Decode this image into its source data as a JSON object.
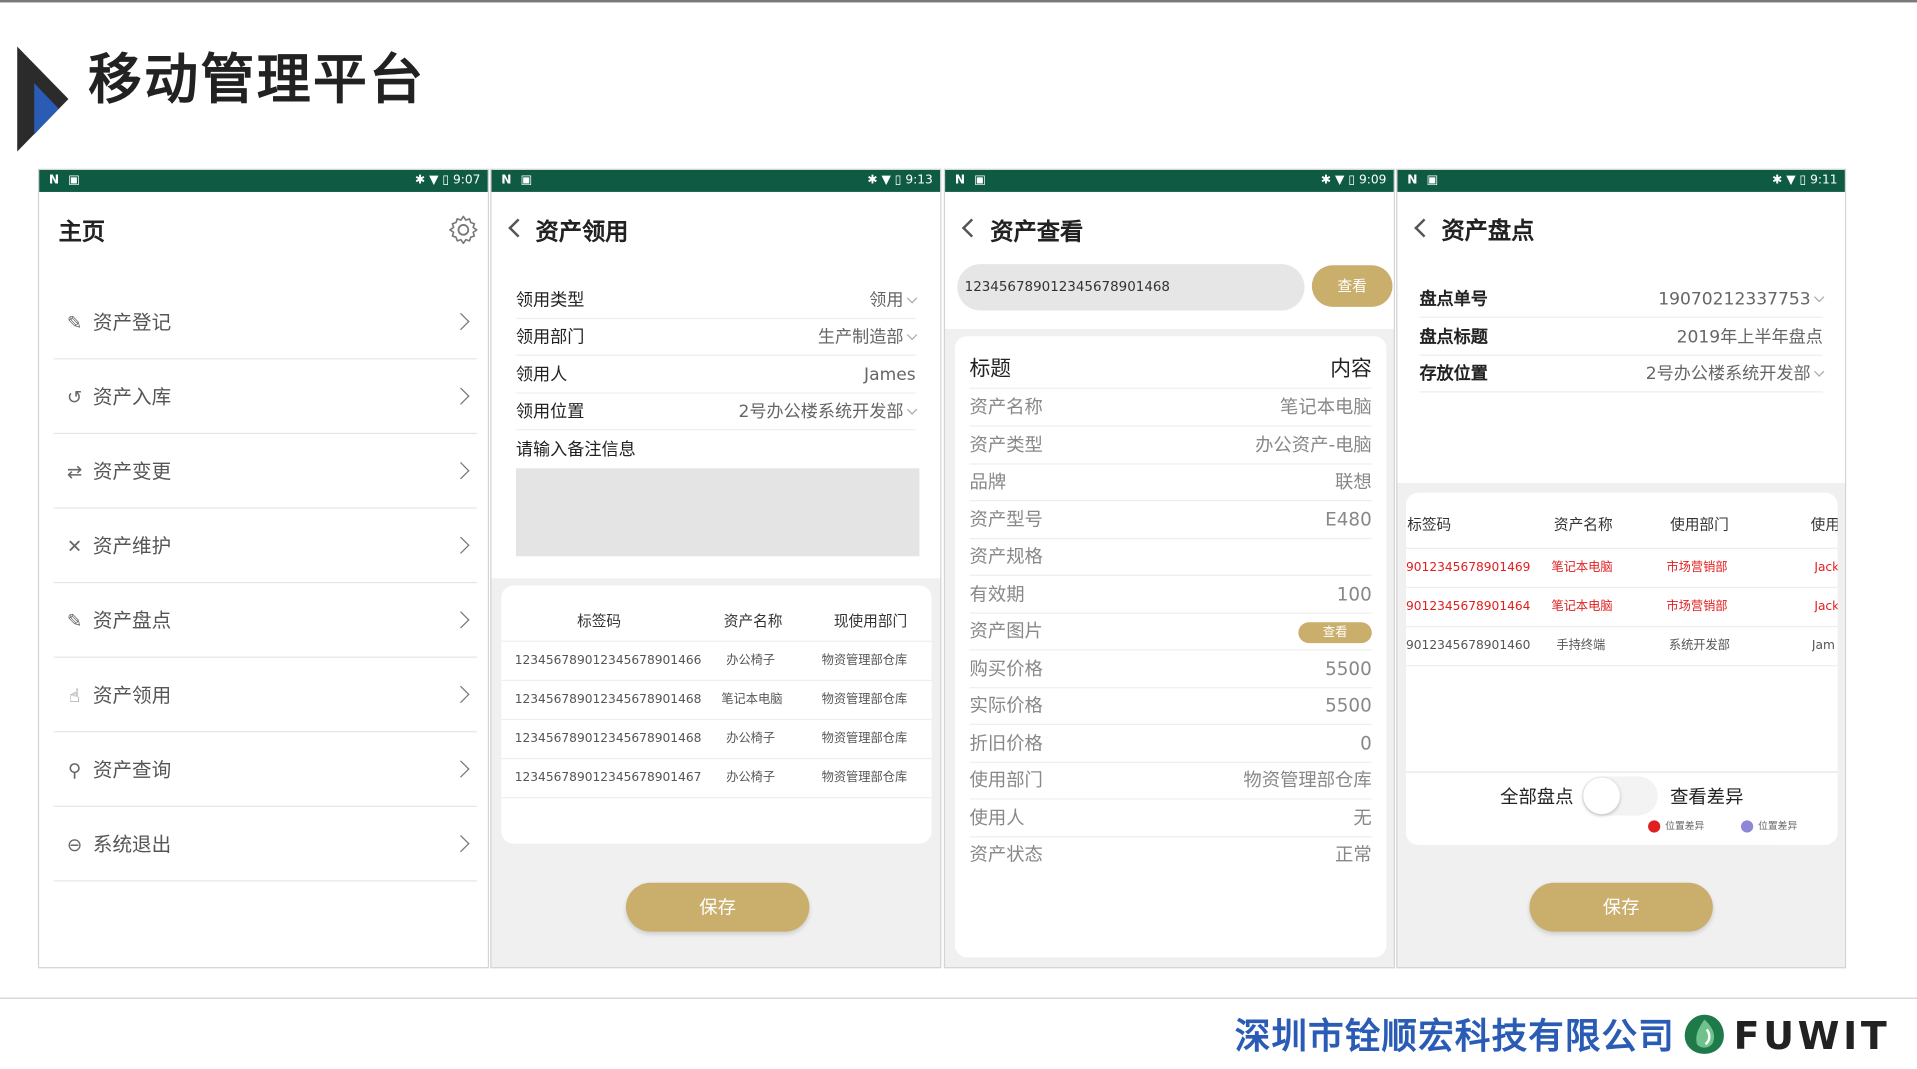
{
  "slide": {
    "title": "移动管理平台",
    "company": "深圳市铨顺宏科技有限公司",
    "brand": "FUWIT",
    "colors": {
      "title_accent": "#2a5bb5",
      "status_bar": "#0e5a43",
      "button": "#c9ae6c",
      "highlight_red": "#e02020"
    }
  },
  "phones": [
    {
      "status": {
        "left": "N ▣",
        "right": "✱ ▼ ▯ 9:07"
      },
      "title": "主页",
      "menu": [
        {
          "icon": "register-icon",
          "glyph": "✎",
          "label": "资产登记"
        },
        {
          "icon": "storage-icon",
          "glyph": "↺",
          "label": "资产入库"
        },
        {
          "icon": "change-icon",
          "glyph": "⇄",
          "label": "资产变更"
        },
        {
          "icon": "repair-icon",
          "glyph": "✕",
          "label": "资产维护"
        },
        {
          "icon": "inventory-icon",
          "glyph": "✎",
          "label": "资产盘点"
        },
        {
          "icon": "receive-icon",
          "glyph": "☝",
          "label": "资产领用"
        },
        {
          "icon": "search-icon",
          "glyph": "⚲",
          "label": "资产查询"
        },
        {
          "icon": "logout-icon",
          "glyph": "⊖",
          "label": "系统退出"
        }
      ]
    },
    {
      "status": {
        "left": "N ▣",
        "right": "✱ ▼ ▯ 9:13"
      },
      "title": "资产领用",
      "form": [
        {
          "label": "领用类型",
          "value": "领用",
          "dropdown": true
        },
        {
          "label": "领用部门",
          "value": "生产制造部",
          "dropdown": true
        },
        {
          "label": "领用人",
          "value": "James",
          "dropdown": false
        },
        {
          "label": "领用位置",
          "value": "2号办公楼系统开发部",
          "dropdown": true
        }
      ],
      "remark_label": "请输入备注信息",
      "table": {
        "headers": [
          "标签码",
          "资产名称",
          "现使用部门"
        ],
        "rows": [
          [
            "123456789012345678901466",
            "办公椅子",
            "物资管理部仓库"
          ],
          [
            "123456789012345678901468",
            "笔记本电脑",
            "物资管理部仓库"
          ],
          [
            "123456789012345678901468",
            "办公椅子",
            "物资管理部仓库"
          ],
          [
            "123456789012345678901467",
            "办公椅子",
            "物资管理部仓库"
          ]
        ]
      },
      "save_label": "保存"
    },
    {
      "status": {
        "left": "N ▣",
        "right": "✱ ▼ ▯ 9:09"
      },
      "title": "资产查看",
      "search_value": "123456789012345678901468",
      "search_button": "查看",
      "detail_header": {
        "label": "标题",
        "value": "内容"
      },
      "details": [
        {
          "label": "资产名称",
          "value": "笔记本电脑"
        },
        {
          "label": "资产类型",
          "value": "办公资产-电脑"
        },
        {
          "label": "品牌",
          "value": "联想"
        },
        {
          "label": "资产型号",
          "value": "E480"
        },
        {
          "label": "资产规格",
          "value": ""
        },
        {
          "label": "有效期",
          "value": "100"
        },
        {
          "label": "资产图片",
          "value": "查看",
          "button": true
        },
        {
          "label": "购买价格",
          "value": "5500"
        },
        {
          "label": "实际价格",
          "value": "5500"
        },
        {
          "label": "折旧价格",
          "value": "0"
        },
        {
          "label": "使用部门",
          "value": "物资管理部仓库"
        },
        {
          "label": "使用人",
          "value": "无"
        },
        {
          "label": "资产状态",
          "value": "正常"
        }
      ]
    },
    {
      "status": {
        "left": "N ▣",
        "right": "✱ ▼ ▯ 9:11"
      },
      "title": "资产盘点",
      "form": [
        {
          "label": "盘点单号",
          "value": "19070212337753",
          "dropdown": true
        },
        {
          "label": "盘点标题",
          "value": "2019年上半年盘点",
          "dropdown": false
        },
        {
          "label": "存放位置",
          "value": "2号办公楼系统开发部",
          "dropdown": true
        }
      ],
      "table": {
        "headers": [
          "标签码",
          "资产名称",
          "使用部门",
          "使用"
        ],
        "rows": [
          {
            "cells": [
              "9012345678901469",
              "笔记本电脑",
              "市场营销部",
              "Jack"
            ],
            "highlight": true
          },
          {
            "cells": [
              "9012345678901464",
              "笔记本电脑",
              "市场营销部",
              "Jack"
            ],
            "highlight": true
          },
          {
            "cells": [
              "9012345678901460",
              "手持终端",
              "系统开发部",
              "Jam"
            ],
            "highlight": false
          }
        ]
      },
      "all_label": "全部盘点",
      "diff_label": "查看差异",
      "legend": [
        {
          "label": "位置差异",
          "color": "#e02020"
        },
        {
          "label": "位置差异",
          "color": "#8e86d8"
        }
      ],
      "save_label": "保存"
    }
  ]
}
